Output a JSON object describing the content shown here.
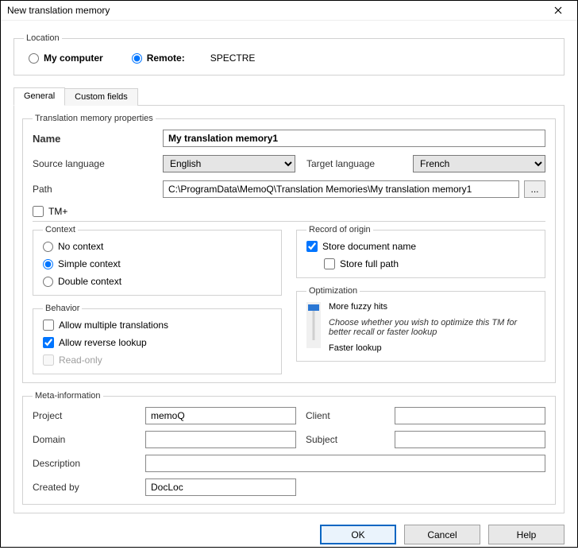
{
  "window": {
    "title": "New translation memory"
  },
  "location": {
    "legend": "Location",
    "my_computer": "My computer",
    "remote": "Remote:",
    "server_name": "SPECTRE",
    "selected": "remote"
  },
  "tabs": {
    "general": "General",
    "custom_fields": "Custom fields"
  },
  "props": {
    "legend": "Translation memory properties",
    "name_label": "Name",
    "name_value": "My translation memory1",
    "source_lang_label": "Source language",
    "source_lang_value": "English",
    "target_lang_label": "Target language",
    "target_lang_value": "French",
    "path_label": "Path",
    "path_value": "C:\\ProgramData\\MemoQ\\Translation Memories\\My translation memory1",
    "browse_label": "...",
    "tm_plus_label": "TM+"
  },
  "context": {
    "legend": "Context",
    "no_context": "No context",
    "simple_context": "Simple context",
    "double_context": "Double context",
    "selected": "simple"
  },
  "behavior": {
    "legend": "Behavior",
    "allow_multiple": "Allow multiple translations",
    "allow_reverse": "Allow reverse lookup",
    "read_only": "Read-only",
    "allow_multiple_checked": false,
    "allow_reverse_checked": true,
    "read_only_checked": false
  },
  "record": {
    "legend": "Record of origin",
    "store_doc_name": "Store document name",
    "store_full_path": "Store full path",
    "store_doc_checked": true,
    "store_full_checked": false
  },
  "optimization": {
    "legend": "Optimization",
    "more_fuzzy": "More fuzzy hits",
    "desc": "Choose whether you wish to optimize this TM for better recall or faster lookup",
    "faster_lookup": "Faster lookup"
  },
  "meta": {
    "legend": "Meta-information",
    "project_label": "Project",
    "project_value": "memoQ",
    "client_label": "Client",
    "client_value": "",
    "domain_label": "Domain",
    "domain_value": "",
    "subject_label": "Subject",
    "subject_value": "",
    "description_label": "Description",
    "description_value": "",
    "created_by_label": "Created by",
    "created_by_value": "DocLoc"
  },
  "buttons": {
    "ok": "OK",
    "cancel": "Cancel",
    "help": "Help"
  }
}
